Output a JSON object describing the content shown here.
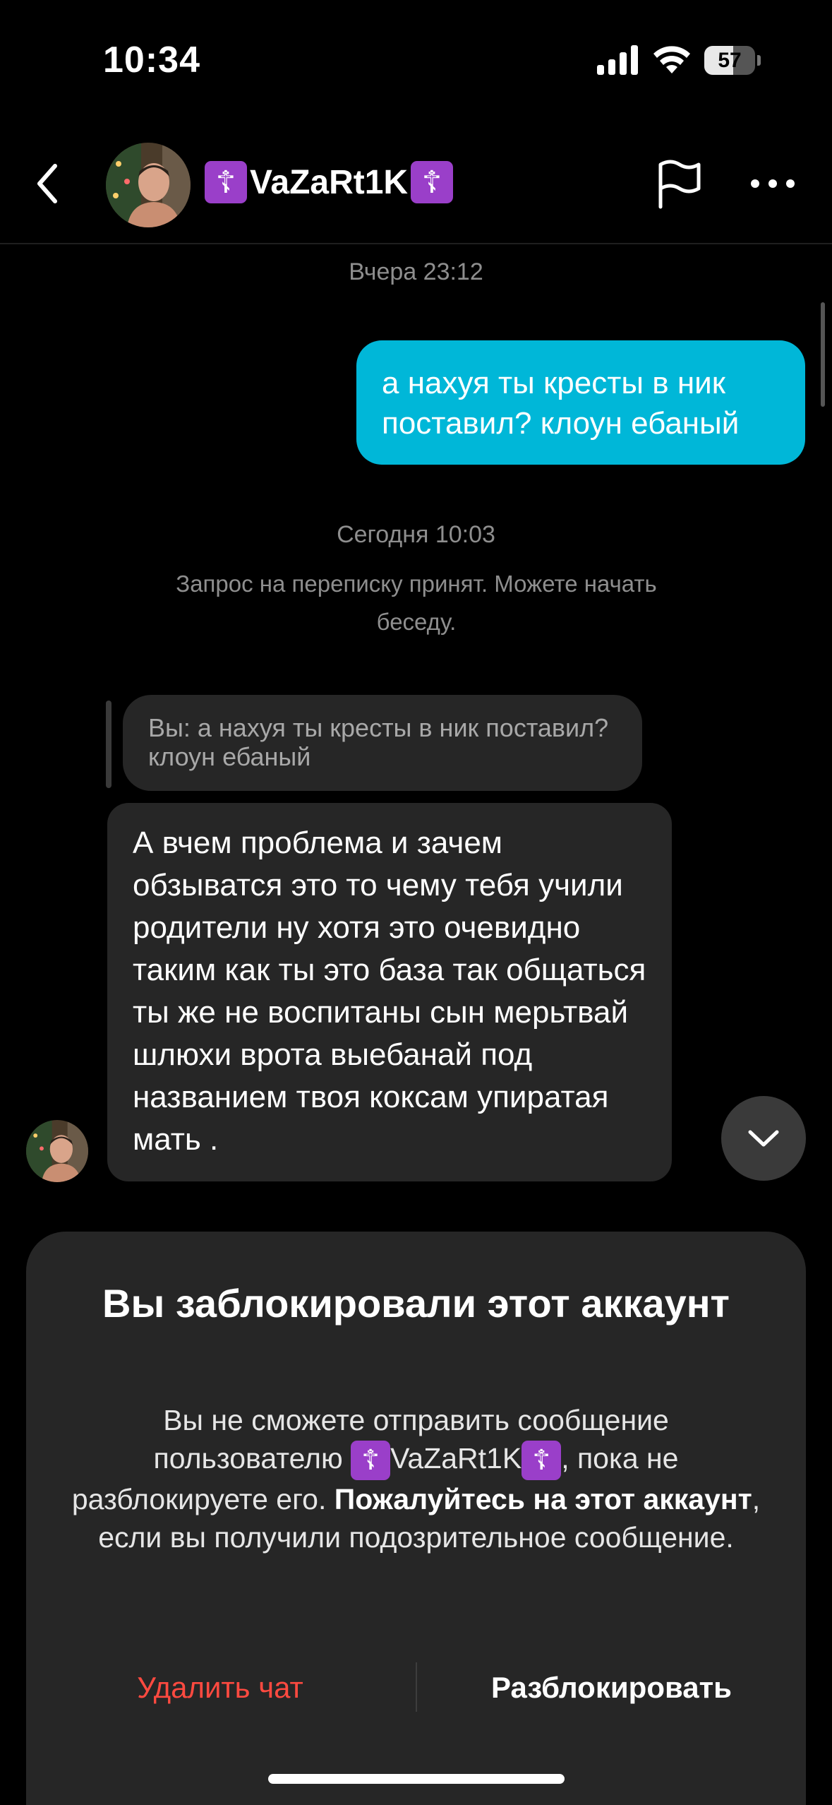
{
  "status_bar": {
    "time": "10:34",
    "battery": "57",
    "battery_level": 0.57
  },
  "header": {
    "username": "VaZaRt1K",
    "left_emoji": "☦",
    "right_emoji": "☦",
    "icons": [
      "back-icon",
      "flag-icon",
      "more-icon"
    ]
  },
  "messages": {
    "timestamp_yesterday": "Вчера 23:12",
    "outgoing_text": "а нахуя ты кресты в ник поставил? клоун ебаный",
    "timestamp_today": "Сегодня 10:03",
    "system_note": "Запрос на переписку принят. Можете начать беседу.",
    "reply_preview": "Вы: а нахуя ты кресты в ник поставил? клоун ебаный",
    "incoming_text": "А вчем проблема и зачем обзыватся это то чему тебя учили родители ну хотя это очевидно таким как ты это база так общаться ты же не воспитаны сын мерьтвай шлюхи врота выебанай под названием твоя коксам упиратая мать ."
  },
  "blocked_panel": {
    "title": "Вы заблокировали этот аккаунт",
    "body_prefix": "Вы не сможете отправить сообщение пользователю ",
    "username": "VaZaRt1K",
    "body_middle": ", пока не разблокируете его. ",
    "body_bold": "Пожалуйтесь на этот аккаунт",
    "body_suffix": ", если вы получили подозрительное сообщение.",
    "delete_label": "Удалить чат",
    "unblock_label": "Разблокировать"
  },
  "colors": {
    "outgoing_bubble": "#00b7d8",
    "incoming_bubble": "#262626",
    "delete_text": "#ff4a40",
    "emoji_bg": "#9a3fc9"
  }
}
